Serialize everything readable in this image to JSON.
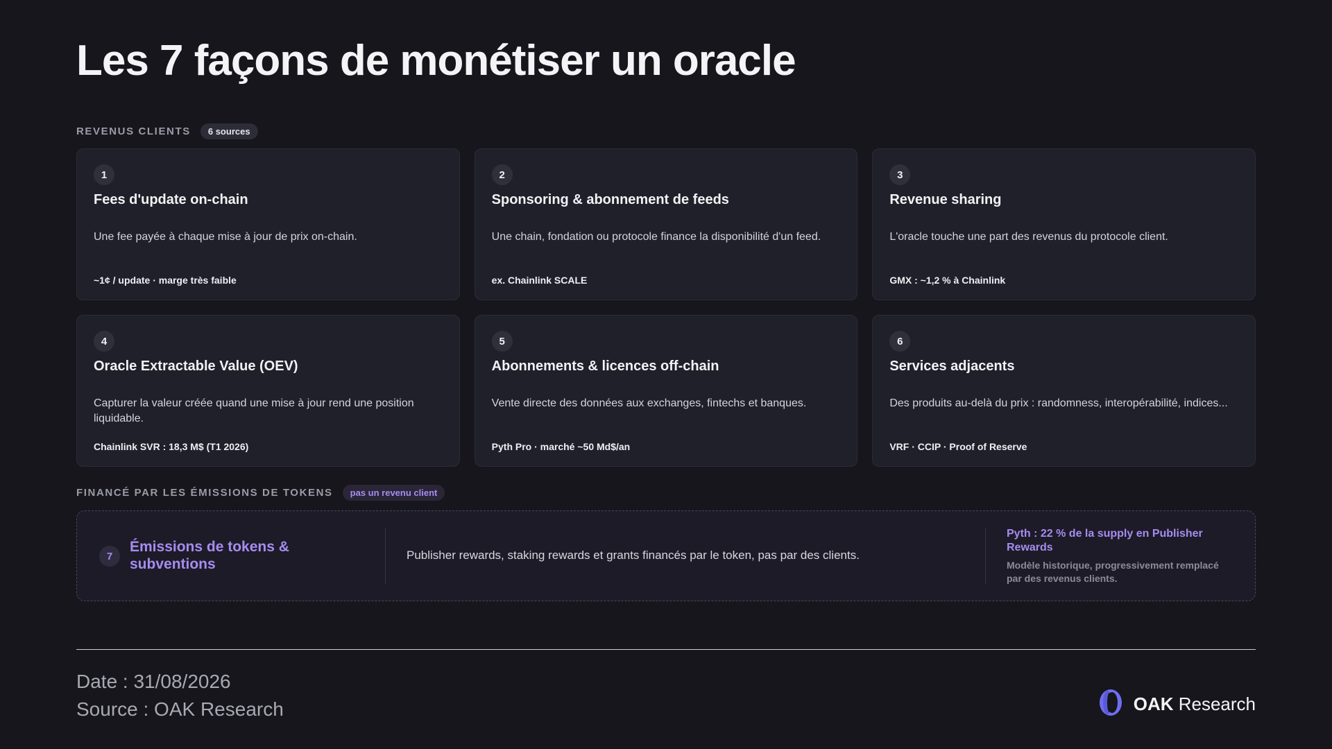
{
  "header": {
    "title": "Les 7 façons de monétiser un oracle"
  },
  "clients_section": {
    "label": "REVENUS CLIENTS",
    "badge": "6 sources",
    "cards": [
      {
        "num": "1",
        "title": "Fees d'update on-chain",
        "desc": "Une fee payée à chaque mise à jour de prix on-chain.",
        "meta": "~1¢ / update · marge très faible"
      },
      {
        "num": "2",
        "title": "Sponsoring & abonnement de feeds",
        "desc": "Une chain, fondation ou protocole finance la disponibilité d'un feed.",
        "meta": "ex. Chainlink SCALE"
      },
      {
        "num": "3",
        "title": "Revenue sharing",
        "desc": "L'oracle touche une part des revenus du protocole client.",
        "meta": "GMX : ~1,2 % à Chainlink"
      },
      {
        "num": "4",
        "title": "Oracle Extractable Value (OEV)",
        "desc": "Capturer la valeur créée quand une mise à jour rend une position liquidable.",
        "meta": "Chainlink SVR : 18,3 M$ (T1 2026)"
      },
      {
        "num": "5",
        "title": "Abonnements & licences off-chain",
        "desc": "Vente directe des données aux exchanges, fintechs et banques.",
        "meta": "Pyth Pro · marché ~50 Md$/an"
      },
      {
        "num": "6",
        "title": "Services adjacents",
        "desc": "Des produits au-delà du prix : randomness, interopérabilité, indices...",
        "meta": "VRF · CCIP · Proof of Reserve"
      }
    ]
  },
  "tokens_section": {
    "label": "FINANCÉ PAR LES ÉMISSIONS DE TOKENS",
    "badge": "pas un revenu client",
    "card": {
      "num": "7",
      "title": "Émissions de tokens & subventions",
      "desc": "Publisher rewards, staking rewards et grants financés par le token, pas par des clients.",
      "side_main": "Pyth : 22 % de la supply en Publisher Rewards",
      "side_sub": "Modèle historique, progressivement remplacé par des revenus clients."
    }
  },
  "footer": {
    "date": "Date : 31/08/2026",
    "source": "Source : OAK Research",
    "brand_bold": "OAK",
    "brand_rest": " Research",
    "logo_icon": "oak-logo-icon"
  },
  "colors": {
    "background": "#16161c",
    "card": "#20202a",
    "accent_purple": "#a68cf0",
    "logo_blue": "#6f6ef0"
  }
}
